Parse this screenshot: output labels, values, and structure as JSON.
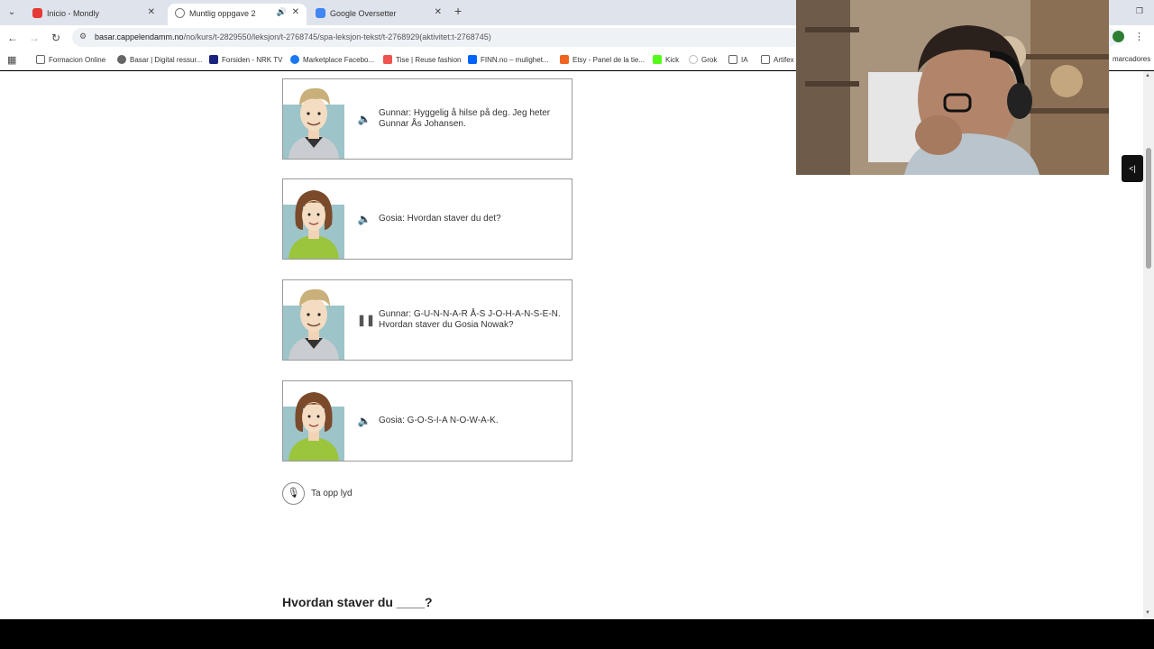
{
  "browser": {
    "tabs": [
      {
        "title": "Inicio - Mondly",
        "color": "#e53935"
      },
      {
        "title": "Muntlig oppgave 2",
        "color": "#777777"
      },
      {
        "title": "Google Oversetter",
        "color": "#4285f4"
      }
    ],
    "url_host": "basar.cappelendamm.no",
    "url_path": "/no/kurs/t-2829550/leksjon/t-2768745/spa-leksjon-tekst/t-2768929(aktivitet:t-2768745)",
    "bookmarks": [
      {
        "label": "Formacion Online",
        "color": "#888888"
      },
      {
        "label": "Basar | Digital ressur...",
        "color": "#666666"
      },
      {
        "label": "Forsiden - NRK TV",
        "color": "#1a237e"
      },
      {
        "label": "Marketplace Facebo...",
        "color": "#1877f2"
      },
      {
        "label": "Tise | Reuse fashion",
        "color": "#ef5350"
      },
      {
        "label": "FINN.no – mulighet...",
        "color": "#0063fb"
      },
      {
        "label": "Etsy - Panel de la tie...",
        "color": "#f1641e"
      },
      {
        "label": "Kick",
        "color": "#53fc18"
      },
      {
        "label": "Grok",
        "color": "#bbbbbb"
      },
      {
        "label": "IA",
        "color": "#888888"
      },
      {
        "label": "Artifex",
        "color": "#888888"
      },
      {
        "label": "marcadores",
        "color": "#888888"
      }
    ]
  },
  "dialogue": [
    {
      "speaker": "gunnar",
      "state": "play",
      "text": "Gunnar: Hyggelig å hilse på deg. Jeg heter Gunnar Ås Johansen."
    },
    {
      "speaker": "gosia",
      "state": "play",
      "text": "Gosia: Hvordan staver du det?"
    },
    {
      "speaker": "gunnar",
      "state": "pause",
      "text": "Gunnar: G-U-N-N-A-R   Å-S   J-O-H-A-N-S-E-N. Hvordan staver du Gosia Nowak?"
    },
    {
      "speaker": "gosia",
      "state": "play",
      "text": "Gosia: G-O-S-I-A   N-O-W-A-K."
    }
  ],
  "record": {
    "label": "Ta opp lyd"
  },
  "question": {
    "text": "Hvordan staver du ____?"
  }
}
